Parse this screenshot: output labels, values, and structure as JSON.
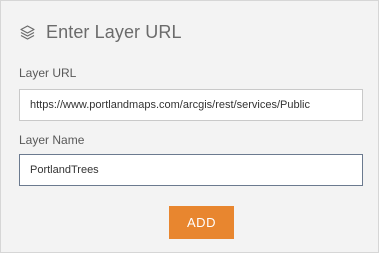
{
  "dialog": {
    "title": "Enter Layer URL",
    "icon": "layers-icon"
  },
  "form": {
    "url_label": "Layer URL",
    "url_value": "https://www.portlandmaps.com/arcgis/rest/services/Public",
    "name_label": "Layer Name",
    "name_value": "PortlandTrees",
    "add_label": "ADD"
  },
  "colors": {
    "accent": "#e8862f",
    "background": "#f3f3f3",
    "text": "#6b6b6b"
  }
}
